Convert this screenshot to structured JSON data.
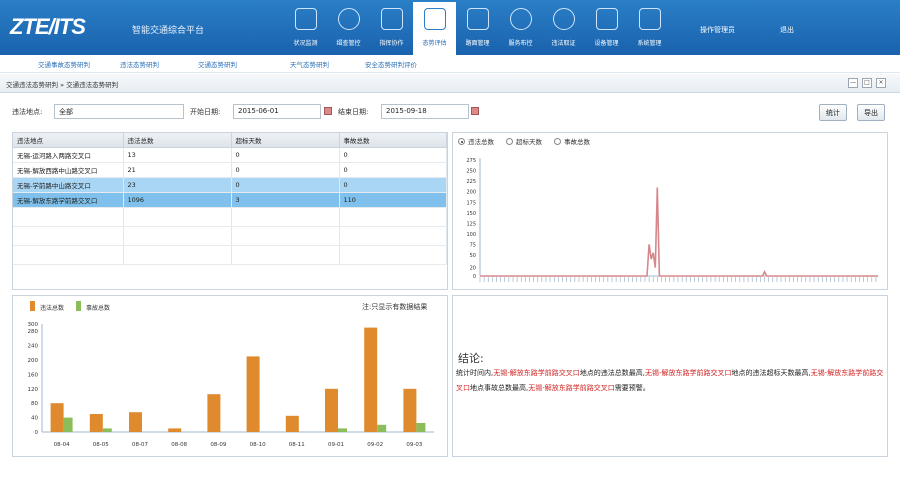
{
  "header": {
    "logo": "ZTE/ITS",
    "subtitle": "智能交通综合平台",
    "nav": [
      {
        "label": "状况监测",
        "icon": "monitor-icon"
      },
      {
        "label": "缉查管控",
        "icon": "car-icon"
      },
      {
        "label": "指挥协作",
        "icon": "people-icon"
      },
      {
        "label": "态势评估",
        "icon": "trend-icon"
      },
      {
        "label": "路面管理",
        "icon": "screen-icon"
      },
      {
        "label": "服务布控",
        "icon": "face-icon"
      },
      {
        "label": "违法取证",
        "icon": "camera-icon"
      },
      {
        "label": "设备管理",
        "icon": "device-icon"
      },
      {
        "label": "系统管理",
        "icon": "computer-icon"
      }
    ],
    "active_nav_index": 3,
    "links": [
      "操作管理员",
      "退出"
    ]
  },
  "subnav": [
    "交通事故态势研判",
    "违法态势研判",
    "交通态势研判",
    "天气态势研判",
    "安全态势研判评价"
  ],
  "breadcrumb": "交通违法态势研判 » 交通违法态势研判",
  "window_controls": [
    "—",
    "□",
    "×"
  ],
  "filters": {
    "place_label": "违法地点:",
    "place_value": "全部",
    "start_label": "开始日期:",
    "start_value": "2015-06-01",
    "end_label": "结束日期:",
    "end_value": "2015-09-18",
    "stats_button": "统计",
    "export_button": "导出"
  },
  "table": {
    "columns": [
      "违法地点",
      "违法总数",
      "超标天数",
      "事故总数"
    ],
    "rows": [
      [
        "无锡-运河路入两路交叉口",
        "13",
        "0",
        "0"
      ],
      [
        "无锡-解放西路中山路交叉口",
        "21",
        "0",
        "0"
      ],
      [
        "无锡-学前路中山路交叉口",
        "23",
        "0",
        "0"
      ],
      [
        "无锡-解放东路学前路交叉口",
        "1096",
        "3",
        "110"
      ]
    ],
    "selected_rows": [
      2,
      3
    ]
  },
  "radios": [
    {
      "label": "违法总数",
      "checked": true
    },
    {
      "label": "超标天数",
      "checked": false
    },
    {
      "label": "事故总数",
      "checked": false
    }
  ],
  "note": "注:只显示有数据结果",
  "bar_legend": [
    "违法总数",
    "事故总数"
  ],
  "colors": {
    "header": "#1a62ad",
    "bar1": "#e08a2e",
    "bar2": "#8bbd5a",
    "line": "#d6878a",
    "selected": "#a9d6f5",
    "conclusion_red": "#d11f1f"
  },
  "conclusion": {
    "title": "结论:",
    "parts": [
      {
        "text": "统计时间内,",
        "red": false
      },
      {
        "text": "无锡-解放东路学前路交叉口",
        "red": true
      },
      {
        "text": "地点的违法总数最高,",
        "red": false
      },
      {
        "text": "无锡-解放东路学前路交叉口",
        "red": true
      },
      {
        "text": "地点的违法超标天数最高,",
        "red": false
      },
      {
        "text": "无锡-解放东路学前路交叉口",
        "red": true
      },
      {
        "text": "地点事故总数最高,",
        "red": false
      },
      {
        "text": "无锡-解放东路学前路交叉口",
        "red": true
      },
      {
        "text": "需要预警。",
        "red": false
      }
    ]
  },
  "chart_data": [
    {
      "type": "bar",
      "categories": [
        "08-04",
        "08-05",
        "08-07",
        "08-08",
        "08-09",
        "08-10",
        "08-11",
        "09-01",
        "09-02",
        "09-03"
      ],
      "series": [
        {
          "name": "违法总数",
          "values": [
            80,
            50,
            55,
            10,
            105,
            210,
            45,
            120,
            290,
            120
          ]
        },
        {
          "name": "事故总数",
          "values": [
            40,
            10,
            0,
            0,
            0,
            0,
            0,
            10,
            20,
            25
          ]
        }
      ],
      "yticks": [
        0,
        40,
        80,
        120,
        160,
        200,
        240,
        280,
        300
      ],
      "ylim": [
        0,
        300
      ]
    },
    {
      "type": "line",
      "series": [
        {
          "values": [
            0,
            0,
            0,
            0,
            0,
            0,
            0,
            0,
            0,
            0,
            0,
            0,
            0,
            0,
            0,
            0,
            0,
            0,
            0,
            0,
            0,
            0,
            0,
            0,
            0,
            0,
            0,
            0,
            0,
            0,
            0,
            0,
            0,
            0,
            0,
            0,
            0,
            0,
            0,
            0,
            0,
            0,
            0,
            0,
            0,
            0,
            0,
            0,
            0,
            0,
            0,
            0,
            0,
            0,
            0,
            0,
            0,
            0,
            0,
            0,
            0,
            0,
            0,
            0,
            0,
            0,
            0,
            0,
            0,
            0,
            0,
            0,
            0,
            0,
            0,
            0,
            0,
            0,
            0,
            0,
            0,
            0,
            75,
            40,
            55,
            20,
            210,
            0,
            0,
            0,
            0,
            0,
            0,
            0,
            0,
            0,
            0,
            0,
            0,
            0,
            0,
            0,
            0,
            0,
            0,
            0,
            0,
            0,
            0,
            0,
            0,
            0,
            0,
            0,
            0,
            0,
            0,
            0,
            0,
            0,
            0,
            0,
            0,
            0,
            0,
            0,
            0,
            0,
            0,
            0,
            0,
            0,
            0,
            0,
            0,
            0,
            0,
            0,
            10,
            0,
            0,
            0,
            0,
            0,
            0,
            0,
            0,
            0,
            0,
            0,
            0,
            0,
            0,
            0,
            0,
            0,
            0,
            0,
            0,
            0,
            0,
            0,
            0,
            0,
            0,
            0,
            0,
            0,
            0,
            0,
            0,
            0,
            0,
            0,
            0,
            0,
            0,
            0,
            0,
            0,
            0,
            0,
            0,
            0,
            0,
            0,
            0,
            0,
            0,
            0,
            0,
            0,
            0,
            0
          ]
        }
      ],
      "yticks": [
        0,
        20,
        50,
        75,
        100,
        125,
        150,
        175,
        200,
        225,
        250,
        275
      ],
      "ylim": [
        0,
        280
      ]
    }
  ]
}
